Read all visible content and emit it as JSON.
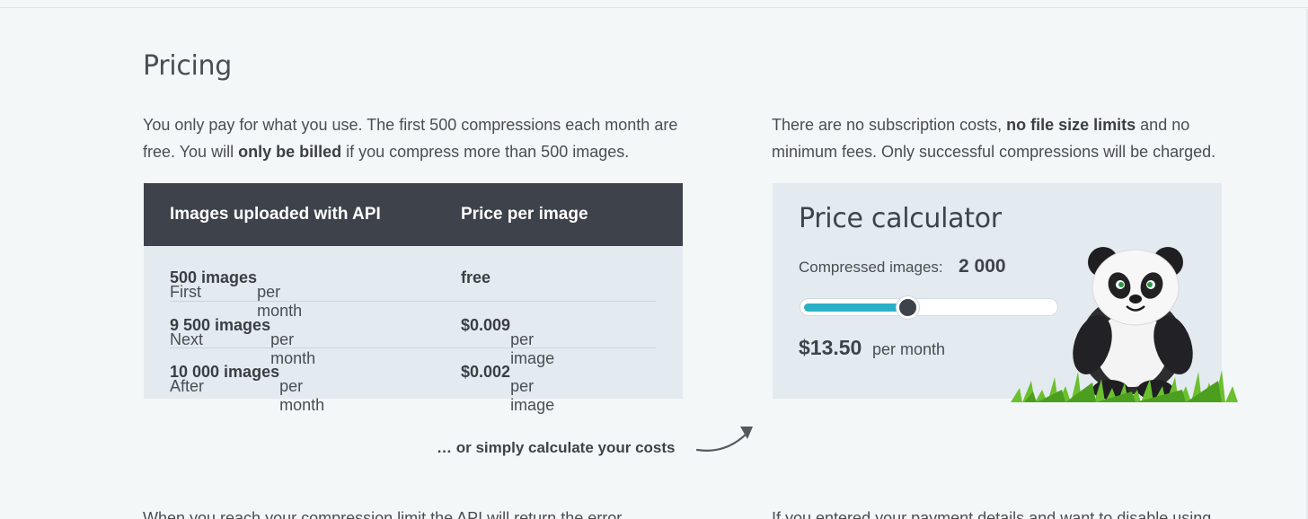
{
  "section": {
    "title": "Pricing"
  },
  "intro_left": {
    "part1": "You only pay for what you use. The first 500 compressions each month are free. You will ",
    "bold": "only be billed",
    "part2": " if you compress more than 500 images."
  },
  "intro_right": {
    "part1": "There are no subscription costs, ",
    "bold": "no file size limits",
    "part2": " and no minimum fees. Only successful compressions will be charged."
  },
  "pricing_table": {
    "headers": [
      "Images uploaded with API",
      "Price per image"
    ],
    "rows": [
      {
        "prefix": "First ",
        "bold": "500 images",
        "suffix": " per month",
        "price_bold": "free",
        "price_suffix": ""
      },
      {
        "prefix": "Next ",
        "bold": "9 500 images",
        "suffix": " per month",
        "price_bold": "$0.009",
        "price_suffix": " per image"
      },
      {
        "prefix": "After ",
        "bold": "10 000 images",
        "suffix": " per month",
        "price_bold": "$0.002",
        "price_suffix": " per image"
      }
    ]
  },
  "calculator": {
    "title": "Price calculator",
    "label": "Compressed images:",
    "count": "2 000",
    "slider_fraction": 0.38,
    "price": "$13.50",
    "per": "per month",
    "mascot": "panda-mascot-icon"
  },
  "cta": {
    "text": "… or simply calculate your costs"
  },
  "bottom": {
    "left": "When you reach your compression limit the API will return the error",
    "right": "If you entered your payment details and want to disable using"
  },
  "colors": {
    "accent": "#2bb0c8",
    "header_bg": "#3e424b",
    "free_green": "#79ad2e",
    "panel_bg": "#e3ebf0"
  }
}
